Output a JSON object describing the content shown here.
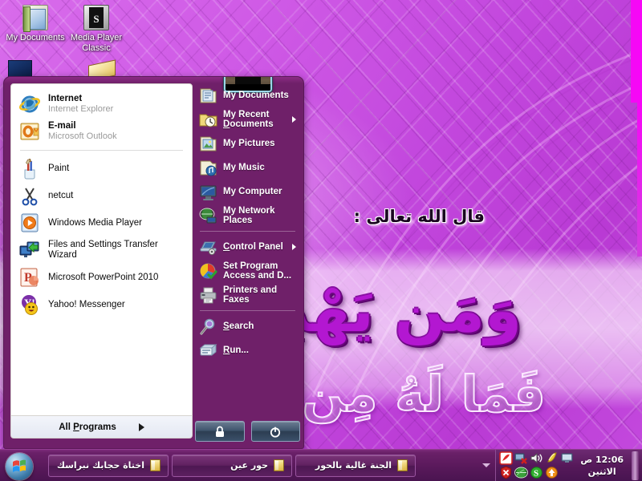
{
  "desktop": {
    "icons": [
      {
        "name": "my-documents",
        "label": "My Documents",
        "icon": "folder-documents-icon"
      },
      {
        "name": "media-player-classic",
        "label": "Media Player\nClassic",
        "icon": "film-strip-icon"
      }
    ],
    "wallpaper": {
      "heading": "قال الله تعالى :",
      "line1": "وَمَن يَهْدِ",
      "line2": "فَمَا لَهُ مِن مُضِ",
      "accent_color": "#c84ae0",
      "strip_color": "#f508f5"
    }
  },
  "start_menu": {
    "user_picture": "kaaba-photo",
    "left_panel": {
      "pinned": [
        {
          "title": "Internet",
          "subtitle": "Internet Explorer",
          "icon": "internet-explorer-icon"
        },
        {
          "title": "E-mail",
          "subtitle": "Microsoft Outlook",
          "icon": "outlook-icon"
        }
      ],
      "programs": [
        {
          "title": "Paint",
          "icon": "paint-icon"
        },
        {
          "title": "netcut",
          "icon": "netcut-scissors-icon"
        },
        {
          "title": "Windows Media Player",
          "icon": "windows-media-player-icon"
        },
        {
          "title": "Files and Settings Transfer Wizard",
          "icon": "transfer-wizard-icon"
        },
        {
          "title": "Microsoft PowerPoint 2010",
          "icon": "powerpoint-icon"
        },
        {
          "title": "Yahoo! Messenger",
          "icon": "yahoo-messenger-icon"
        }
      ],
      "all_programs": {
        "label_prefix": "All ",
        "label_accel": "P",
        "label_suffix": "rograms"
      }
    },
    "right_panel": {
      "group1": [
        {
          "label": "My Documents",
          "icon": "my-documents-icon",
          "submenu": false
        },
        {
          "label": "My Recent Documents",
          "accel": "D",
          "icon": "my-recent-documents-icon",
          "submenu": true
        },
        {
          "label": "My Pictures",
          "icon": "my-pictures-icon",
          "submenu": false
        },
        {
          "label": "My Music",
          "icon": "my-music-icon",
          "submenu": false
        },
        {
          "label": "My Computer",
          "icon": "my-computer-icon",
          "submenu": false
        },
        {
          "label": "My Network Places",
          "icon": "my-network-places-icon",
          "submenu": false
        }
      ],
      "group2": [
        {
          "label": "Control Panel",
          "accel": "C",
          "icon": "control-panel-icon",
          "submenu": true
        },
        {
          "label": "Set Program Access and D...",
          "icon": "set-program-access-icon",
          "submenu": false
        },
        {
          "label": "Printers and Faxes",
          "icon": "printers-and-faxes-icon",
          "submenu": false
        }
      ],
      "group3": [
        {
          "label": "Search",
          "accel": "S",
          "icon": "search-icon",
          "submenu": false
        },
        {
          "label": "Run...",
          "accel": "R",
          "icon": "run-icon",
          "submenu": false
        }
      ],
      "buttons": [
        {
          "name": "log-off-button",
          "icon": "lock-icon"
        },
        {
          "name": "turn-off-computer-button",
          "icon": "power-icon"
        }
      ]
    }
  },
  "taskbar": {
    "start_button": {
      "name": "start-button",
      "icon": "windows-orb-icon"
    },
    "windows": [
      {
        "label": "اختاة حجابك نبراسك",
        "icon": "folder-icon",
        "active": false
      },
      {
        "label": "حور عين",
        "icon": "folder-icon",
        "active": false
      },
      {
        "label": "الجنة غالية بالحور",
        "icon": "folder-icon",
        "active": false
      }
    ],
    "tray": {
      "expand_icon": "chevron-left-icon",
      "icons": [
        {
          "name": "antivirus-icon",
          "color": "#e03030"
        },
        {
          "name": "network-disconnected-icon",
          "color": "#4a6b8a"
        },
        {
          "name": "volume-icon",
          "color": "#f0f0f0"
        },
        {
          "name": "yellow-shield-icon",
          "color": "#e8c838"
        },
        {
          "name": "display-icon",
          "color": "#6a8ab0"
        },
        {
          "name": "security-alert-icon",
          "color": "#cc2222"
        },
        {
          "name": "globe-icon",
          "color": "#3aa03a"
        },
        {
          "name": "skype-icon",
          "color": "#2fae2f"
        },
        {
          "name": "update-arrow-icon",
          "color": "#f09018"
        }
      ],
      "clock_time": "12:06 ص",
      "clock_day": "الاثنين"
    }
  }
}
